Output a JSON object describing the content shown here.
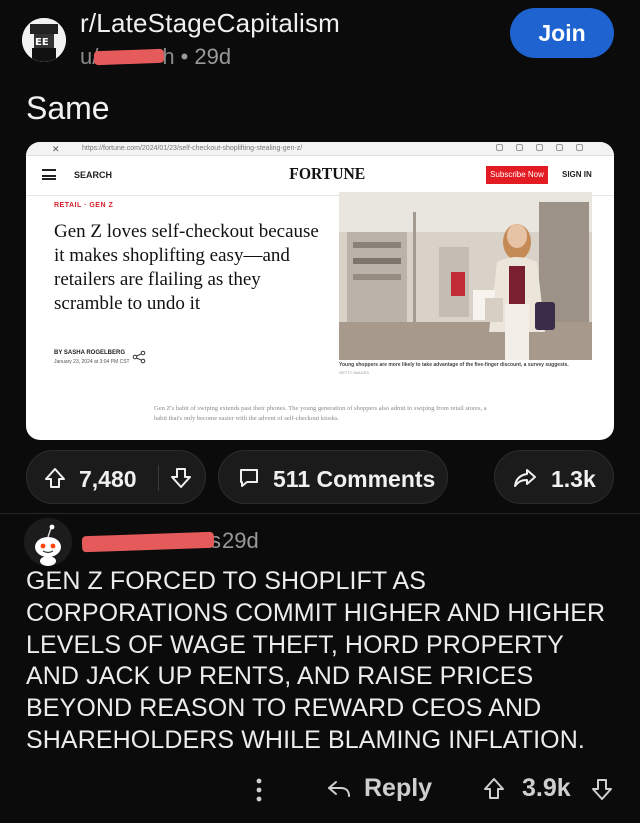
{
  "post": {
    "subreddit": "r/LateStageCapitalism",
    "author_visible": "u/",
    "author_tail": "h",
    "age": "• 29d",
    "join_label": "Join",
    "title": "Same"
  },
  "embed": {
    "url": "https://fortune.com/2024/01/23/self-checkout-shoplifting-stealing-gen-z/",
    "search_label": "SEARCH",
    "logo": "FORTUNE",
    "subscribe_label": "Subscribe Now",
    "signin_label": "SIGN IN",
    "kicker": "RETAIL · GEN Z",
    "headline": "Gen Z loves self-checkout because it makes shoplifting easy—and retailers are flailing as they scramble to undo it",
    "byline": "BY SASHA ROGELBERG",
    "date": "January 23, 2024 at 3:04 PM CST",
    "caption": "Young shoppers are more likely to take advantage of the five-finger discount, a survey suggests.",
    "credit": "GETTY IMAGES",
    "body": "Gen Z's habit of swiping extends past their phones. The young generation of shoppers also admit to swiping from retail stores, a habit that's only become easier with the advent of self-checkout kiosks."
  },
  "actions": {
    "upvotes": "7,480",
    "comments": "511 Comments",
    "shares": "1.3k"
  },
  "comment": {
    "author_tail": "s",
    "age": "29d",
    "body": "GEN Z FORCED TO SHOPLIFT AS CORPORATIONS COMMIT HIGHER AND HIGHER LEVELS OF WAGE THEFT, HORD PROPERTY AND JACK UP RENTS, AND RAISE PRICES BEYOND REASON TO REWARD CEOS AND SHAREHOLDERS WHILE BLAMING INFLATION.",
    "reply_label": "Reply",
    "score": "3.9k"
  },
  "colors": {
    "background": "#0b0b0b",
    "join": "#1e63cf",
    "redaction": "#e55a5a",
    "fortune_red": "#e31b23"
  }
}
